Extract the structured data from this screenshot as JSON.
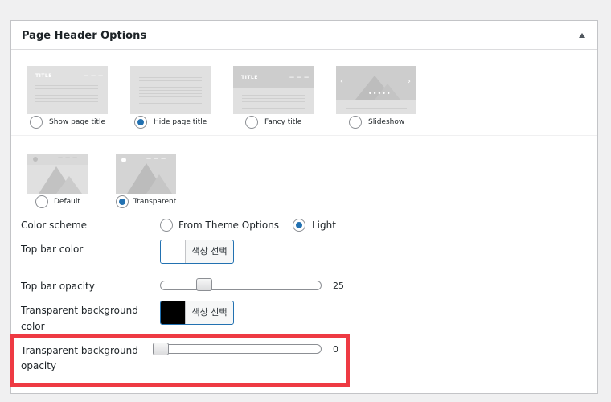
{
  "panel": {
    "title": "Page Header Options"
  },
  "title_styles": [
    {
      "label": "Show page title",
      "checked": false
    },
    {
      "label": "Hide page title",
      "checked": true
    },
    {
      "label": "Fancy title",
      "checked": false
    },
    {
      "label": "Slideshow",
      "checked": false
    }
  ],
  "header_styles": [
    {
      "label": "Default",
      "checked": false
    },
    {
      "label": "Transparent",
      "checked": true
    }
  ],
  "thumb_text": {
    "title": "TITLE",
    "dashes": "— — —"
  },
  "color_scheme": {
    "label": "Color scheme",
    "options": [
      {
        "label": "From Theme Options",
        "checked": false
      },
      {
        "label": "Light",
        "checked": true
      }
    ]
  },
  "top_bar_color": {
    "label": "Top bar color",
    "button_label": "색상 선택",
    "swatch_color": "#ffffff"
  },
  "top_bar_opacity": {
    "label": "Top bar opacity",
    "value": "25",
    "fraction": 0.25
  },
  "transparent_bg_color": {
    "label_line1": "Transparent background",
    "label_line2": "color",
    "button_label": "색상 선택",
    "swatch_color": "#000000"
  },
  "transparent_bg_opacity": {
    "label_line1": "Transparent background",
    "label_line2": "opacity",
    "value": "0",
    "fraction": 0
  },
  "colors": {
    "accent": "#2271b1",
    "highlight": "#ee3a43"
  }
}
